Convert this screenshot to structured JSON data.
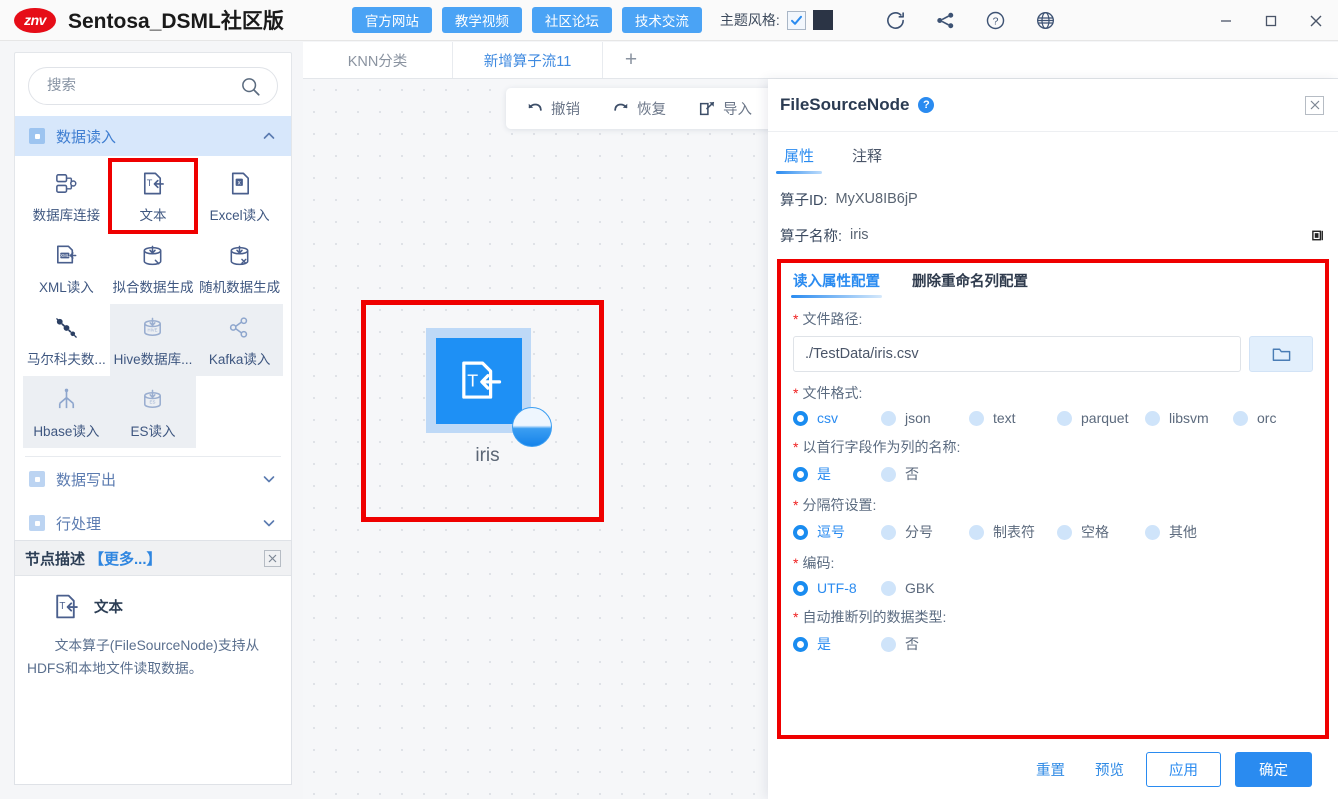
{
  "titlebar": {
    "logo_text": "znv",
    "app_title": "Sentosa_DSML社区版",
    "buttons": [
      {
        "label": "官方网站",
        "name": "official-website-button"
      },
      {
        "label": "教学视频",
        "name": "tutorial-video-button"
      },
      {
        "label": "社区论坛",
        "name": "community-forum-button"
      },
      {
        "label": "技术交流",
        "name": "tech-exchange-button"
      }
    ],
    "theme_label": "主题风格:",
    "theme_checked": true,
    "theme_color": "#2b3445",
    "accent_color": "#2a8bf0",
    "icons": [
      "refresh-icon",
      "share-nodes-icon",
      "help-circle-icon",
      "globe-icon"
    ],
    "window_controls": [
      "minimize-icon",
      "maximize-icon",
      "close-icon"
    ]
  },
  "sidebar": {
    "search": {
      "value": "",
      "placeholder": "搜索",
      "icon": "search-icon"
    },
    "categories": [
      {
        "label": "数据读入",
        "expanded": true,
        "items": [
          {
            "label": "数据库连接",
            "icon": "database-link-icon",
            "shaded": false,
            "highlight": false
          },
          {
            "label": "文本",
            "icon": "text-file-import-icon",
            "shaded": false,
            "highlight": true
          },
          {
            "label": "Excel读入",
            "icon": "excel-file-icon",
            "shaded": false,
            "highlight": false
          },
          {
            "label": "XML读入",
            "icon": "xml-file-icon",
            "shaded": false,
            "highlight": false
          },
          {
            "label": "拟合数据生成",
            "icon": "fit-data-gen-icon",
            "shaded": false,
            "highlight": false
          },
          {
            "label": "随机数据生成",
            "icon": "random-data-gen-icon",
            "shaded": false,
            "highlight": false
          },
          {
            "label": "马尔科夫数...",
            "icon": "markov-chain-icon",
            "shaded": false,
            "highlight": false
          },
          {
            "label": "Hive数据库...",
            "icon": "hive-db-icon",
            "shaded": true,
            "highlight": false
          },
          {
            "label": "Kafka读入",
            "icon": "kafka-icon",
            "shaded": true,
            "highlight": false
          },
          {
            "label": "Hbase读入",
            "icon": "hbase-icon",
            "shaded": true,
            "highlight": false
          },
          {
            "label": "ES读入",
            "icon": "elasticsearch-icon",
            "shaded": true,
            "highlight": false
          }
        ]
      },
      {
        "label": "数据写出",
        "expanded": false,
        "items": []
      },
      {
        "label": "行处理",
        "expanded": false,
        "items": []
      }
    ]
  },
  "node_description": {
    "title": "节点描述",
    "more_label": "【更多...】",
    "close_icon": "close-icon",
    "node_name": "文本",
    "node_icon": "text-file-import-icon",
    "body": "文本算子(FileSourceNode)支持从HDFS和本地文件读取数据。"
  },
  "tabs": {
    "items": [
      {
        "label": "KNN分类",
        "active": false
      },
      {
        "label": "新增算子流11",
        "active": true
      }
    ],
    "add_label": "+"
  },
  "canvas_toolbar": {
    "items": [
      {
        "label": "撤销",
        "icon": "undo-icon"
      },
      {
        "label": "恢复",
        "icon": "redo-icon"
      },
      {
        "label": "导入",
        "icon": "import-icon"
      }
    ]
  },
  "canvas": {
    "node": {
      "label": "iris",
      "icon": "text-file-import-icon",
      "badge": "data-preview-badge",
      "selected": true
    },
    "collapse_handle_icon": "chevron-right-icon"
  },
  "properties": {
    "title": "FileSourceNode",
    "help_icon": "help-circle-icon",
    "close_icon": "close-icon",
    "tabs": [
      {
        "label": "属性",
        "active": true
      },
      {
        "label": "注释",
        "active": false
      }
    ],
    "operator_id_label": "算子ID:",
    "operator_id_value": "MyXU8IB6jP",
    "operator_name_label": "算子名称:",
    "operator_name_value": "iris",
    "name_action_icon": "copy-icon",
    "form_tabs": [
      {
        "label": "读入属性配置",
        "active": true
      },
      {
        "label": "删除重命名列配置",
        "active": false
      }
    ],
    "fields": {
      "file_path": {
        "label": "文件路径:",
        "required": true,
        "value": "./TestData/iris.csv",
        "browse_icon": "folder-icon"
      },
      "file_format": {
        "label": "文件格式:",
        "required": true,
        "options": [
          "csv",
          "json",
          "text",
          "parquet",
          "libsvm",
          "orc"
        ],
        "selected": "csv"
      },
      "header_as_column_names": {
        "label": "以首行字段作为列的名称:",
        "required": true,
        "options": [
          "是",
          "否"
        ],
        "selected": "是"
      },
      "delimiter": {
        "label": "分隔符设置:",
        "required": true,
        "options": [
          "逗号",
          "分号",
          "制表符",
          "空格",
          "其他"
        ],
        "selected": "逗号"
      },
      "encoding": {
        "label": "编码:",
        "required": true,
        "options": [
          "UTF-8",
          "GBK"
        ],
        "selected": "UTF-8"
      },
      "infer_schema": {
        "label": "自动推断列的数据类型:",
        "required": true,
        "options": [
          "是",
          "否"
        ],
        "selected": "是"
      }
    },
    "footer": {
      "reset_label": "重置",
      "preview_label": "预览",
      "apply_label": "应用",
      "confirm_label": "确定"
    }
  }
}
